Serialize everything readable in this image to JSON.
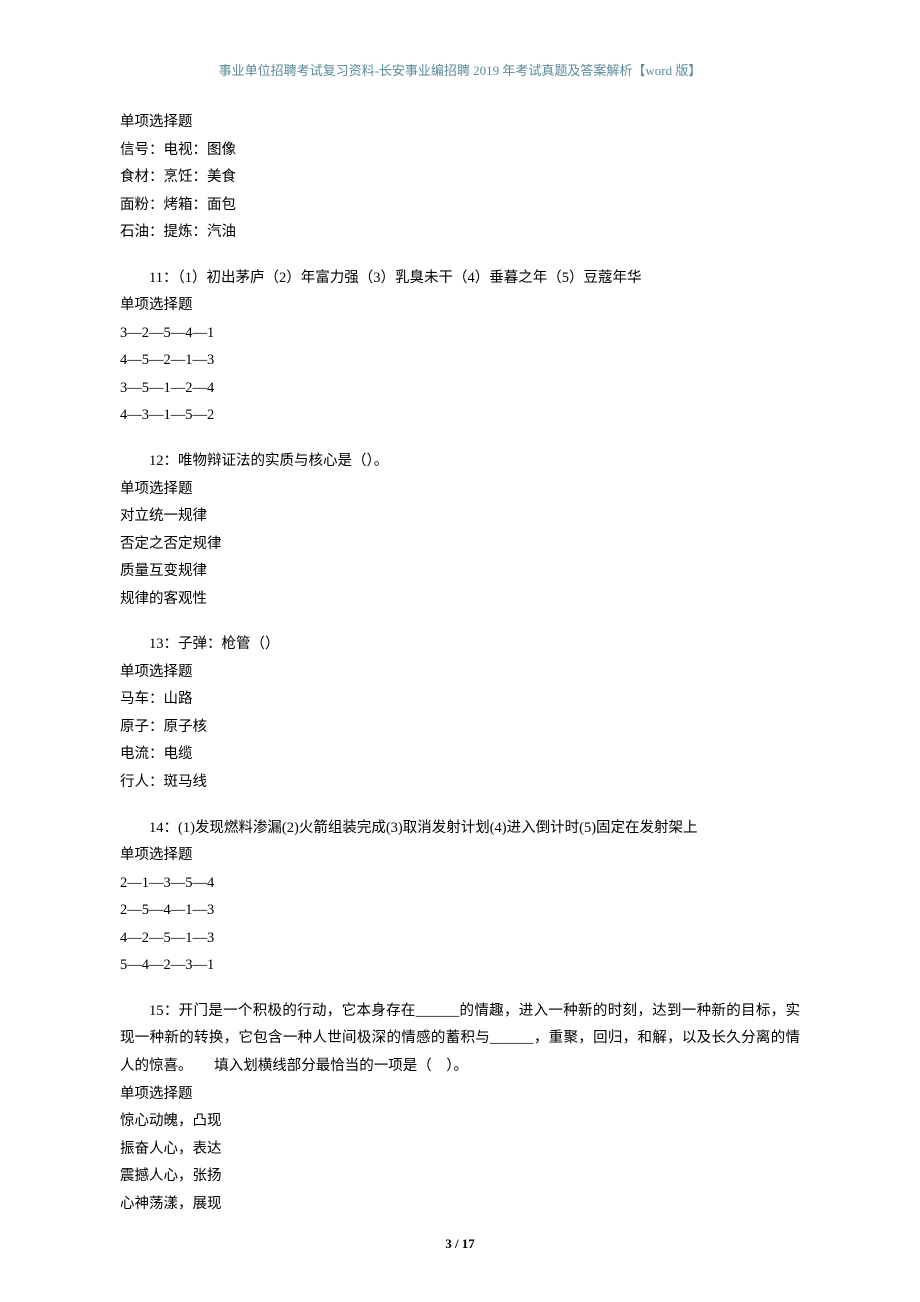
{
  "header": "事业单位招聘考试复习资料-长安事业编招聘 2019 年考试真题及答案解析【word 版】",
  "blocks": [
    {
      "lines": [
        "单项选择题",
        "信号：电视：图像",
        "食材：烹饪：美食",
        "面粉：烤箱：面包",
        "石油：提炼：汽油"
      ]
    },
    {
      "question": "11：（1）初出茅庐（2）年富力强（3）乳臭未干（4）垂暮之年（5）豆蔻年华",
      "lines": [
        "单项选择题",
        "3—2—5—4—1",
        "4—5—2—1—3",
        "3—5—1—2—4",
        "4—3—1—5—2"
      ]
    },
    {
      "question": "12：唯物辩证法的实质与核心是（）。",
      "lines": [
        "单项选择题",
        "对立统一规律",
        "否定之否定规律",
        "质量互变规律",
        "规律的客观性"
      ]
    },
    {
      "question": "13：子弹：枪管（）",
      "lines": [
        "单项选择题",
        "马车：山路",
        "原子：原子核",
        "电流：电缆",
        "行人：斑马线"
      ]
    },
    {
      "question": "14：(1)发现燃料渗漏(2)火箭组装完成(3)取消发射计划(4)进入倒计时(5)固定在发射架上",
      "lines": [
        "单项选择题",
        "2—1—3—5—4",
        "2—5—4—1—3",
        "4—2—5—1—3",
        "5—4—2—3—1"
      ]
    },
    {
      "question": "15：开门是一个积极的行动，它本身存在______的情趣，进入一种新的时刻，达到一种新的目标，实现一种新的转换，它包含一种人世间极深的情感的蓄积与______，重聚，回归，和解，以及长久分离的情人的惊喜。　　填入划横线部分最恰当的一项是（　）。",
      "lines": [
        "单项选择题",
        "惊心动魄，凸现",
        "振奋人心，表达",
        "震撼人心，张扬",
        "心神荡漾，展现"
      ]
    }
  ],
  "footer": "3 / 17"
}
